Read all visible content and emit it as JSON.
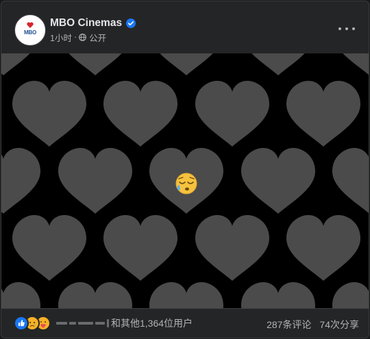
{
  "post": {
    "page_name": "MBO Cinemas",
    "time": "1小时",
    "separator": "·",
    "audience": "公开",
    "avatar_text": "MBO",
    "verified": true
  },
  "image": {
    "description_icon": "sleepy-face-emoji",
    "colors": {
      "background": "#000000",
      "heart": "#4d4d4d",
      "heart_center": "#555555"
    }
  },
  "footer": {
    "reactions": [
      "like",
      "sad",
      "care"
    ],
    "reaction_summary": "和其他1,364位用户",
    "comments": "287条评论",
    "shares": "74次分享"
  },
  "colors": {
    "accent": "#1877f2",
    "card_bg": "#242526",
    "text_primary": "#e4e6eb",
    "text_secondary": "#b0b3b8"
  }
}
